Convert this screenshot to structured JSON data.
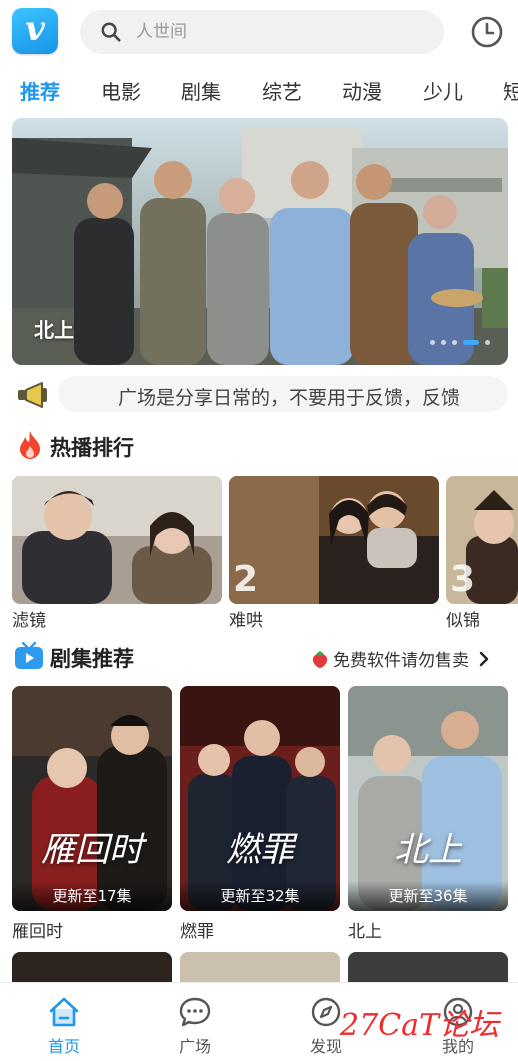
{
  "header": {
    "search_placeholder": "人世间"
  },
  "tabs": [
    "推荐",
    "电影",
    "剧集",
    "综艺",
    "动漫",
    "少儿",
    "短"
  ],
  "banner": {
    "title": "北上",
    "page_count": 5,
    "active_index": 3
  },
  "notice": {
    "text": "广场是分享日常的，不要用于反馈，反馈"
  },
  "hot": {
    "title": "热播排行",
    "items": [
      {
        "title": "滤镜",
        "rank": ""
      },
      {
        "title": "难哄",
        "rank": "2"
      },
      {
        "title": "似锦",
        "rank": "3"
      }
    ]
  },
  "series": {
    "title": "剧集推荐",
    "tip": "免费软件请勿售卖",
    "items": [
      {
        "title": "雁回时",
        "update": "更新至17集",
        "art": "雁回时"
      },
      {
        "title": "燃罪",
        "update": "更新至32集",
        "art": "燃罪"
      },
      {
        "title": "北上",
        "update": "更新至36集",
        "art": "北上"
      }
    ]
  },
  "nav": [
    {
      "label": "首页",
      "active": true
    },
    {
      "label": "广场",
      "active": false
    },
    {
      "label": "发现",
      "active": false
    },
    {
      "label": "我的",
      "active": false
    }
  ],
  "watermark": "27CaT论坛",
  "colors": {
    "accent": "#1f97ee",
    "fire": "#f0442c",
    "watermark": "#ef2b2b"
  }
}
